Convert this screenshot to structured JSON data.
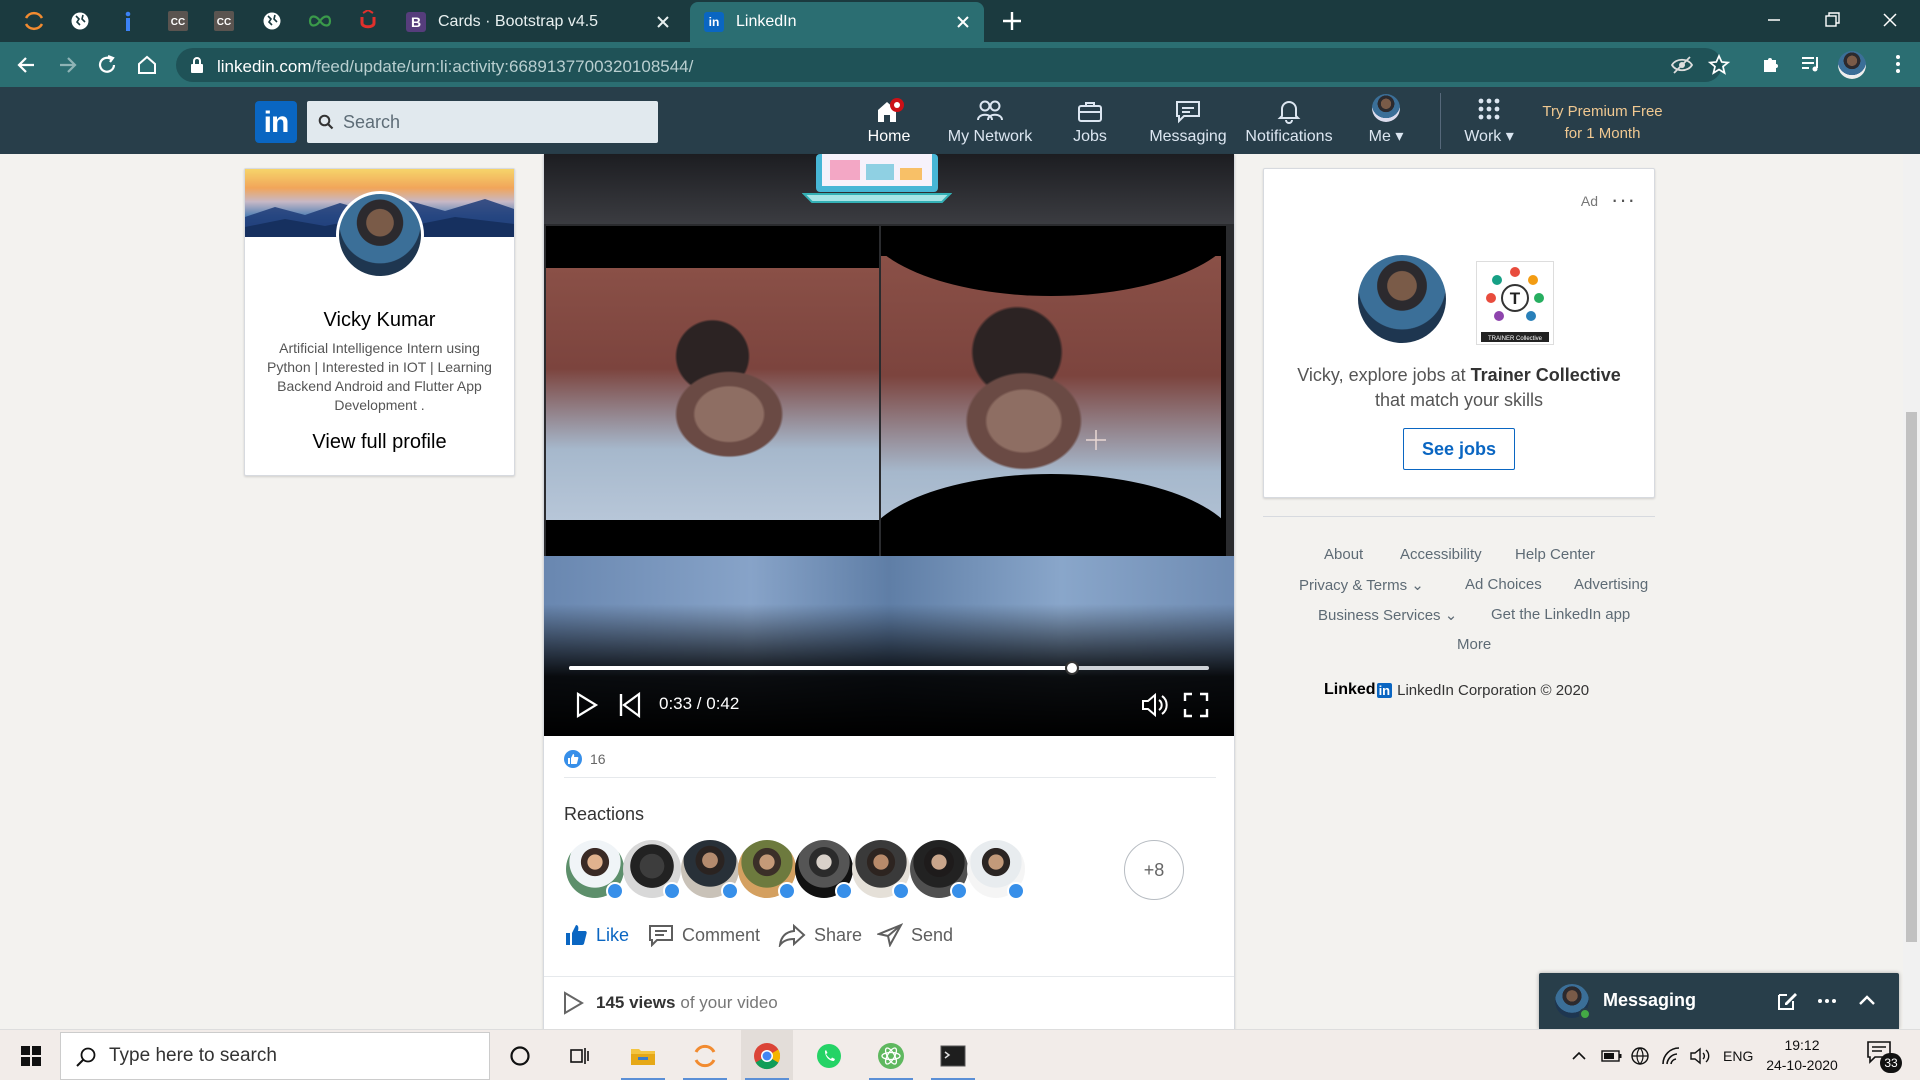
{
  "browser": {
    "tabs": [
      {
        "label": "Cards · Bootstrap v4.5",
        "favicon": "B",
        "favicon_color": "#563d7c"
      },
      {
        "label": "LinkedIn",
        "favicon": "in",
        "favicon_color": "#0a66c2"
      }
    ],
    "url_host": "linkedin.com",
    "url_path": "/feed/update/urn:li:activity:6689137700320108544/"
  },
  "linkedin": {
    "search_placeholder": "Search",
    "nav": [
      {
        "label": "Home",
        "icon": "home-icon",
        "badge": "notification-dot"
      },
      {
        "label": "My Network",
        "icon": "people-icon"
      },
      {
        "label": "Jobs",
        "icon": "briefcase-icon"
      },
      {
        "label": "Messaging",
        "icon": "chat-icon"
      },
      {
        "label": "Notifications",
        "icon": "bell-icon"
      },
      {
        "label": "Me",
        "icon": "avatar"
      },
      {
        "label": "Work",
        "icon": "grid-icon"
      }
    ],
    "premium_line1": "Try Premium Free",
    "premium_line2": "for 1 Month"
  },
  "profile": {
    "name": "Vicky Kumar",
    "headline": "Artificial Intelligence Intern using Python | Interested in IOT | Learning Backend Android and Flutter App Development .",
    "view_link": "View full profile"
  },
  "post": {
    "video_time": "0:33 / 0:42",
    "progress_fraction": 0.786,
    "like_count": "16",
    "reactions_title": "Reactions",
    "more_reactors": "+8",
    "actions": {
      "like": "Like",
      "comment": "Comment",
      "share": "Share",
      "send": "Send"
    },
    "views_count": "145 views",
    "views_suffix": "of your video"
  },
  "ad": {
    "label": "Ad",
    "text_prefix": "Vicky, explore jobs at",
    "company": "Trainer Collective",
    "text_suffix": "that match your skills",
    "button": "See jobs",
    "logo_caption": "TRAINER Collective",
    "logo_letter": "T"
  },
  "footer": {
    "about": "About",
    "accessibility": "Accessibility",
    "help": "Help Center",
    "privacy": "Privacy & Terms",
    "adchoices": "Ad Choices",
    "advertising": "Advertising",
    "business": "Business Services",
    "getapp": "Get the LinkedIn app",
    "more": "More",
    "brand_text": "Linked",
    "brand_box": "in",
    "copyright": "LinkedIn Corporation © 2020"
  },
  "messaging": {
    "title": "Messaging"
  },
  "taskbar": {
    "search_placeholder": "Type here to search",
    "lang": "ENG",
    "time": "19:12",
    "date": "24-10-2020",
    "notif_count": "33"
  }
}
